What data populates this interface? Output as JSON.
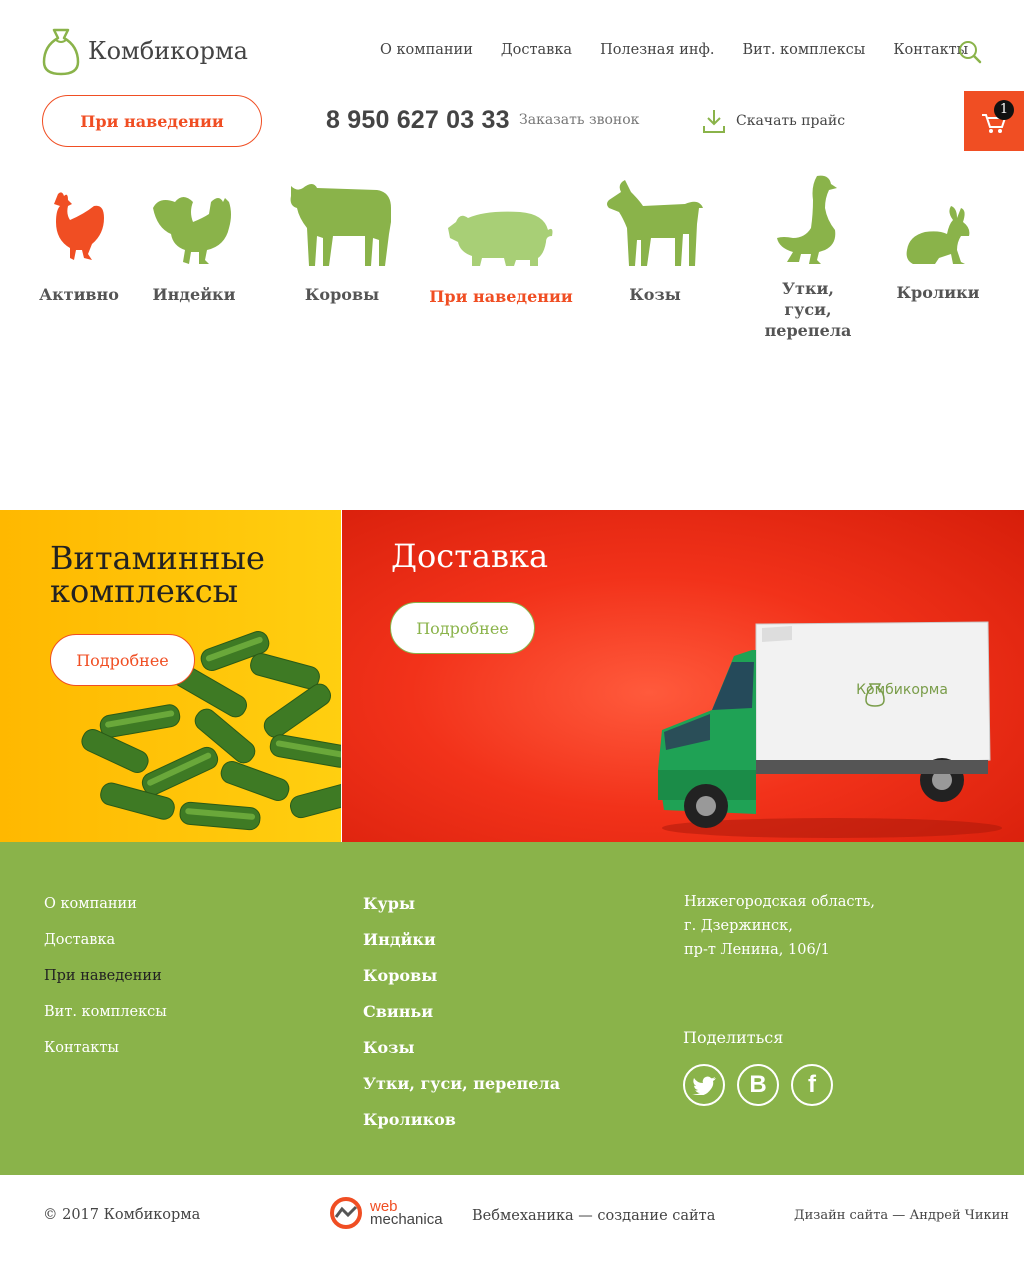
{
  "header": {
    "logo_text": "Комбикорма",
    "nav": [
      "О компании",
      "Доставка",
      "Полезная инф.",
      "Вит. комплексы",
      "Контакты"
    ],
    "hover_button": "При наведении",
    "phone": "8 950 627 03 33",
    "callback": "Заказать звонок",
    "price": "Скачать прайс",
    "cart_count": "1"
  },
  "animals": [
    {
      "label": "Активно",
      "icon": "chicken-icon",
      "color": "#f04e23"
    },
    {
      "label": "Индейки",
      "icon": "turkey-icon",
      "color": "#8ab34a"
    },
    {
      "label": "Коровы",
      "icon": "cow-icon",
      "color": "#8ab34a"
    },
    {
      "label": "При наведении",
      "icon": "pig-icon",
      "color": "#a8cf76"
    },
    {
      "label": "Козы",
      "icon": "goat-icon",
      "color": "#8ab34a"
    },
    {
      "label": "Утки, гуси, перепела",
      "icon": "goose-icon",
      "color": "#8ab34a"
    },
    {
      "label": "Кролики",
      "icon": "rabbit-icon",
      "color": "#8ab34a"
    }
  ],
  "banners": {
    "vitamins": {
      "title_line1": "Витаминные",
      "title_line2": "комплексы",
      "button": "Подробнее"
    },
    "delivery": {
      "title": "Доставка",
      "button": "Подробнее",
      "truck_label": "Комбикорма"
    }
  },
  "footer": {
    "menu": [
      "О компании",
      "Доставка",
      "При наведении",
      "Вит. комплексы",
      "Контакты"
    ],
    "categories": [
      "Куры",
      "Индйки",
      "Коровы",
      "Свиньи",
      "Козы",
      "Утки, гуси, перепела",
      "Кроликов"
    ],
    "address": [
      "Нижегородская область,",
      "г. Дзержинск,",
      "пр-т Ленина, 106/1"
    ],
    "share": "Поделиться"
  },
  "bottom": {
    "copyright": "© 2017 Комбикорма",
    "wm_line1": "web",
    "wm_line2": "mechanica",
    "wm_desc": "Вебмеханика — создание сайта",
    "design": "Дизайн сайта — Андрей Чикин"
  },
  "colors": {
    "accent": "#f04e23",
    "green": "#8ab34a",
    "yellow": "#ffc107",
    "red": "#e8301a"
  }
}
